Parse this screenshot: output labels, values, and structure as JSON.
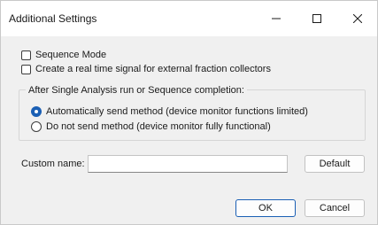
{
  "window": {
    "title": "Additional Settings",
    "controls": {
      "minimize_icon": "minimize-icon",
      "maximize_icon": "maximize-icon",
      "close_icon": "close-icon"
    }
  },
  "options": {
    "sequence_mode": {
      "label": "Sequence Mode",
      "checked": false
    },
    "real_time_signal": {
      "label": "Create a real time signal for external fraction collectors",
      "checked": false
    }
  },
  "completion_group": {
    "label": "After Single Analysis run or Sequence completion:",
    "radios": [
      {
        "label": "Automatically send method (device monitor functions limited)",
        "selected": true
      },
      {
        "label": "Do not send method (device monitor fully functional)",
        "selected": false
      }
    ]
  },
  "custom_name": {
    "label": "Custom name:",
    "value": "",
    "default_button": "Default"
  },
  "footer": {
    "ok_label": "OK",
    "cancel_label": "Cancel"
  },
  "colors": {
    "accent": "#1a5fb4",
    "window_bg": "#f0f0f0",
    "titlebar_bg": "#ffffff"
  }
}
